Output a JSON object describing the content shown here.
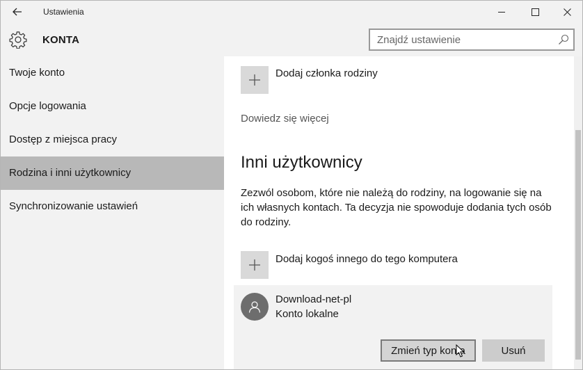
{
  "window": {
    "title": "Ustawienia",
    "buttons": {
      "minimize": "minimize-icon",
      "maximize": "maximize-icon",
      "close": "close-icon"
    }
  },
  "header": {
    "title": "KONTA",
    "icon": "gear-icon"
  },
  "search": {
    "placeholder": "Znajdź ustawienie",
    "icon": "search-icon"
  },
  "sidebar": {
    "items": [
      {
        "label": "Twoje konto",
        "active": false
      },
      {
        "label": "Opcje logowania",
        "active": false
      },
      {
        "label": "Dostęp z miejsca pracy",
        "active": false
      },
      {
        "label": "Rodzina i inni użytkownicy",
        "active": true
      },
      {
        "label": "Synchronizowanie ustawień",
        "active": false
      }
    ]
  },
  "content": {
    "add_family_member": "Dodaj członka rodziny",
    "learn_more": "Dowiedz się więcej",
    "other_users_title": "Inni użytkownicy",
    "other_users_desc": "Zezwól osobom, które nie należą do rodziny, na logowanie się na ich własnych kontach. Ta decyzja nie spowoduje dodania tych osób do rodziny.",
    "add_someone_else": "Dodaj kogoś innego do tego komputera",
    "user": {
      "name": "Download-net-pl",
      "account_type": "Konto lokalne",
      "change_type_label": "Zmień typ konta",
      "remove_label": "Usuń"
    }
  },
  "colors": {
    "sidebar_bg": "#f2f2f2",
    "active_item_bg": "#b8b8b8",
    "tile_bg": "#d9d9d9",
    "button_bg": "#cccccc"
  }
}
